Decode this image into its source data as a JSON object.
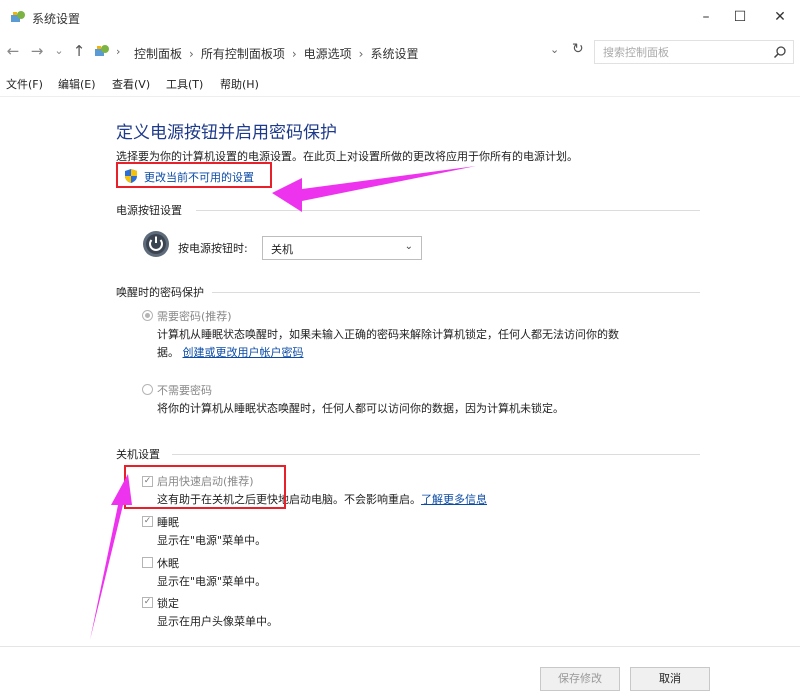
{
  "window": {
    "title": "系统设置",
    "minimize": "–",
    "maximize": "☐",
    "close": "✕"
  },
  "nav": {
    "back": "←",
    "forward": "→",
    "recent": "⌄",
    "up": "↑"
  },
  "address": {
    "crumbs": [
      "控制面板",
      "所有控制面板项",
      "电源选项",
      "系统设置"
    ],
    "separator": "›",
    "dropdown": "⌄",
    "refresh": "↻"
  },
  "search": {
    "placeholder": "搜索控制面板"
  },
  "menu": [
    "文件(F)",
    "编辑(E)",
    "查看(V)",
    "工具(T)",
    "帮助(H)"
  ],
  "page": {
    "title": "定义电源按钮并启用密码保护",
    "description": "选择要为你的计算机设置的电源设置。在此页上对设置所做的更改将应用于你所有的电源计划。",
    "change_link": "更改当前不可用的设置"
  },
  "power_section": {
    "title": "电源按钮设置",
    "label": "按电源按钮时:",
    "selected": "关机",
    "arrow": "⌄"
  },
  "password_section": {
    "title": "唤醒时的密码保护",
    "require_label": "需要密码(推荐)",
    "require_desc_line1": "计算机从睡眠状态唤醒时，如果未输入正确的密码来解除计算机锁定，任何人都无法访问你的数",
    "require_desc_line2_prefix": "据。",
    "require_desc_link": "创建或更改用户帐户密码",
    "norequire_label": "不需要密码",
    "norequire_desc": "将你的计算机从睡眠状态唤醒时，任何人都可以访问你的数据，因为计算机未锁定。",
    "selected": "require"
  },
  "shutdown_section": {
    "title": "关机设置",
    "items": [
      {
        "label": "启用快速启动(推荐)",
        "desc": "这有助于在关机之后更快地启动电脑。不会影响重启。",
        "link": "了解更多信息",
        "checked": true
      },
      {
        "label": "睡眠",
        "desc": "显示在\"电源\"菜单中。",
        "link": "",
        "checked": true
      },
      {
        "label": "休眠",
        "desc": "显示在\"电源\"菜单中。",
        "link": "",
        "checked": false
      },
      {
        "label": "锁定",
        "desc": "显示在用户头像菜单中。",
        "link": "",
        "checked": true
      }
    ],
    "check_glyph": "✓"
  },
  "footer": {
    "save": "保存修改",
    "cancel": "取消"
  },
  "colors": {
    "title": "#1e3a8a",
    "link": "#0a4ba6",
    "highlight": "#e8202a",
    "annotation_arrow": "#ee33ee"
  }
}
